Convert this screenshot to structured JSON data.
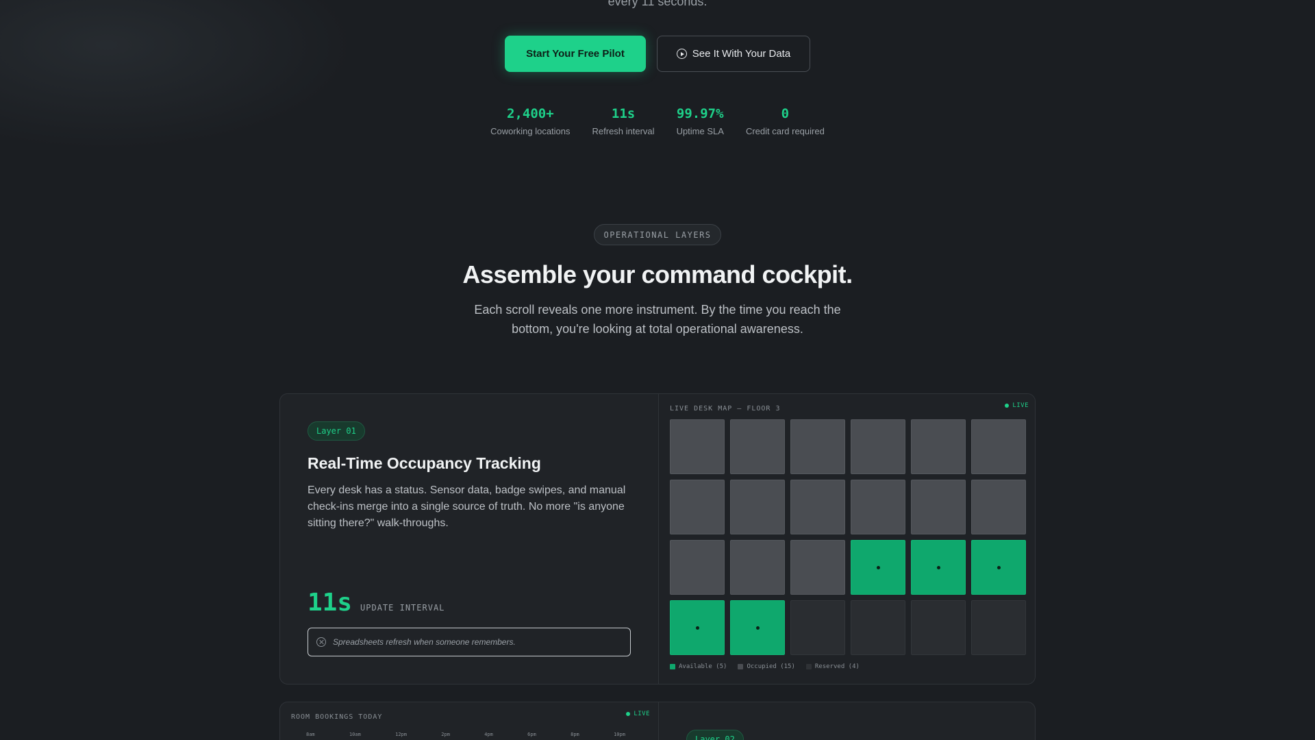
{
  "hero": {
    "top_text": "every 11 seconds.",
    "primary_cta": "Start Your Free Pilot",
    "secondary_cta": "See It With Your Data",
    "stats": [
      {
        "value": "2,400+",
        "label": "Coworking locations"
      },
      {
        "value": "11s",
        "label": "Refresh interval"
      },
      {
        "value": "99.97%",
        "label": "Uptime SLA"
      },
      {
        "value": "0",
        "label": "Credit card required"
      }
    ]
  },
  "section": {
    "eyebrow": "OPERATIONAL LAYERS",
    "title": "Assemble your command cockpit.",
    "subtitle": "Each scroll reveals one more instrument. By the time you reach the bottom, you're looking at total operational awareness."
  },
  "layer1": {
    "badge": "Layer 01",
    "title": "Real-Time Occupancy Tracking",
    "description": "Every desk has a status. Sensor data, badge swipes, and manual check-ins merge into a single source of truth. No more \"is anyone sitting there?\" walk-throughs.",
    "metric_value": "11s",
    "metric_label": "UPDATE INTERVAL",
    "compare_text": "Spreadsheets refresh when someone remembers.",
    "panel": {
      "label": "LIVE DESK MAP — FLOOR 3",
      "live": "LIVE",
      "desks": [
        "occupied",
        "occupied",
        "occupied",
        "occupied",
        "occupied",
        "occupied",
        "occupied",
        "occupied",
        "occupied",
        "occupied",
        "occupied",
        "occupied",
        "occupied",
        "occupied",
        "occupied",
        "available",
        "available",
        "available",
        "available",
        "available",
        "reserved",
        "reserved",
        "reserved",
        "reserved"
      ],
      "legend": [
        {
          "status": "available",
          "label": "Available (5)"
        },
        {
          "status": "occupied",
          "label": "Occupied (15)"
        },
        {
          "status": "reserved",
          "label": "Reserved (4)"
        }
      ]
    }
  },
  "layer2": {
    "badge": "Layer 02",
    "panel": {
      "label": "ROOM BOOKINGS TODAY",
      "live": "LIVE",
      "times": [
        "8am",
        "10am",
        "12pm",
        "2pm",
        "4pm",
        "6pm",
        "8pm",
        "10pm"
      ]
    }
  },
  "colors": {
    "accent": "#1ed18a",
    "background": "#1b1e22",
    "available": "#0fa86d",
    "occupied": "#4a4d52",
    "reserved": "#2a2d31"
  }
}
